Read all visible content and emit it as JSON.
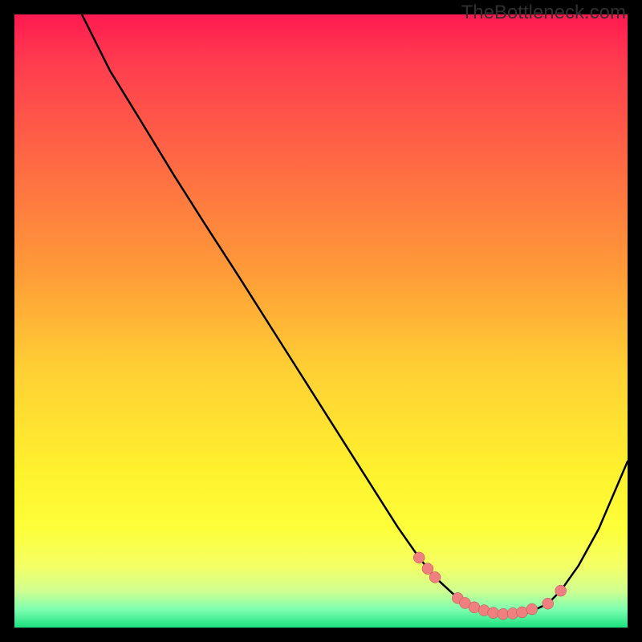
{
  "watermark": "TheBottleneck.com",
  "colors": {
    "background": "#000000",
    "curve_stroke": "#000000",
    "dot_fill": "#f08080",
    "dot_stroke": "#b84a4a"
  },
  "chart_data": {
    "type": "line",
    "title": "",
    "xlabel": "",
    "ylabel": "",
    "xlim": [
      0,
      100
    ],
    "ylim": [
      0,
      100
    ],
    "grid": false,
    "note": "No numeric axes are displayed on the image. x and y are normalized percentages (0–100) across the visible plot area. y = 0 is the top edge of the gradient; y = 100 is the bottom.",
    "series": [
      {
        "name": "main-curve",
        "x": [
          11.0,
          15.6,
          21.0,
          26.0,
          31.2,
          36.5,
          41.7,
          46.9,
          52.1,
          57.3,
          62.5,
          66.0,
          68.6,
          72.3,
          76.0,
          80.0,
          84.0,
          87.0,
          89.1,
          92.0,
          95.3,
          100.0
        ],
        "y": [
          0.0,
          9.2,
          18.0,
          26.2,
          34.4,
          42.6,
          50.8,
          59.0,
          67.2,
          75.4,
          83.6,
          88.6,
          91.8,
          95.2,
          97.0,
          97.8,
          97.5,
          96.1,
          94.0,
          89.9,
          83.9,
          72.9
        ]
      }
    ],
    "annotations": {
      "dots": {
        "name": "highlight-dots",
        "description": "Salmon-colored points near the curve's minimum region",
        "points": [
          {
            "x": 66.0,
            "y": 88.6
          },
          {
            "x": 67.4,
            "y": 90.4
          },
          {
            "x": 68.6,
            "y": 91.8
          },
          {
            "x": 72.3,
            "y": 95.2
          },
          {
            "x": 73.5,
            "y": 96.0
          },
          {
            "x": 75.0,
            "y": 96.7
          },
          {
            "x": 76.6,
            "y": 97.2
          },
          {
            "x": 78.1,
            "y": 97.6
          },
          {
            "x": 79.7,
            "y": 97.8
          },
          {
            "x": 81.3,
            "y": 97.7
          },
          {
            "x": 82.8,
            "y": 97.5
          },
          {
            "x": 84.4,
            "y": 97.0
          },
          {
            "x": 87.0,
            "y": 96.1
          },
          {
            "x": 89.1,
            "y": 94.0
          }
        ]
      }
    }
  }
}
